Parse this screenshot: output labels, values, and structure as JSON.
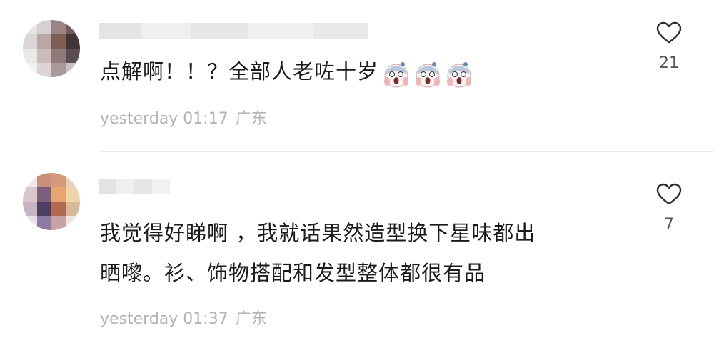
{
  "comments": [
    {
      "text_lines": [
        "点解啊！！？全部人老咗十岁"
      ],
      "emojis": [
        "screaming-face-icon",
        "screaming-face-icon",
        "screaming-face-icon"
      ],
      "time": "yesterday 01:17",
      "location": "广东",
      "likes": "21",
      "username_redacted": true,
      "avatar_redacted": true
    },
    {
      "text_lines": [
        "我觉得好睇啊 ，我就话果然造型换下星味都出",
        "晒嚟。衫、饰物搭配和发型整体都很有品"
      ],
      "emojis": [],
      "time": "yesterday 01:37",
      "location": "广东",
      "likes": "7",
      "username_redacted": true,
      "avatar_redacted": true
    }
  ],
  "colors": {
    "text": "#1a1a1a",
    "meta": "#b3b3b3",
    "like_count": "#555555",
    "divider": "#ececec",
    "heart_stroke": "#2b2b2b"
  }
}
